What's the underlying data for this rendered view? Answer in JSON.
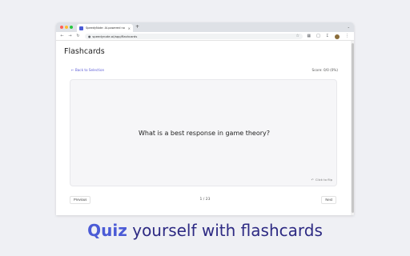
{
  "browser": {
    "tab_title": "SpeedyNote: AI-powered no",
    "tab_close": "×",
    "new_tab": "+",
    "tab_menu": "⌄",
    "url": "speedynote.ai/app/flashcards",
    "icons": [
      "back-icon",
      "forward-icon",
      "reload-icon",
      "lock-icon",
      "star-icon",
      "extension-icon",
      "side-panel-icon",
      "download-icon",
      "avatar",
      "menu-icon"
    ]
  },
  "page": {
    "title": "Flashcards",
    "back_link": "← Back to Selection",
    "score": "Score: 0/0 (0%)"
  },
  "card": {
    "question": "What is a best response in game theory?",
    "flip_hint": "Click to flip"
  },
  "pagination": {
    "previous": "Previous",
    "counter": "1 / 23",
    "next": "Next"
  },
  "caption": {
    "bold": "Quiz",
    "rest": " yourself with flashcards"
  },
  "colors": {
    "accent": "#4b5bd6",
    "caption_text": "#2d2a83",
    "background": "#eff0f4"
  }
}
